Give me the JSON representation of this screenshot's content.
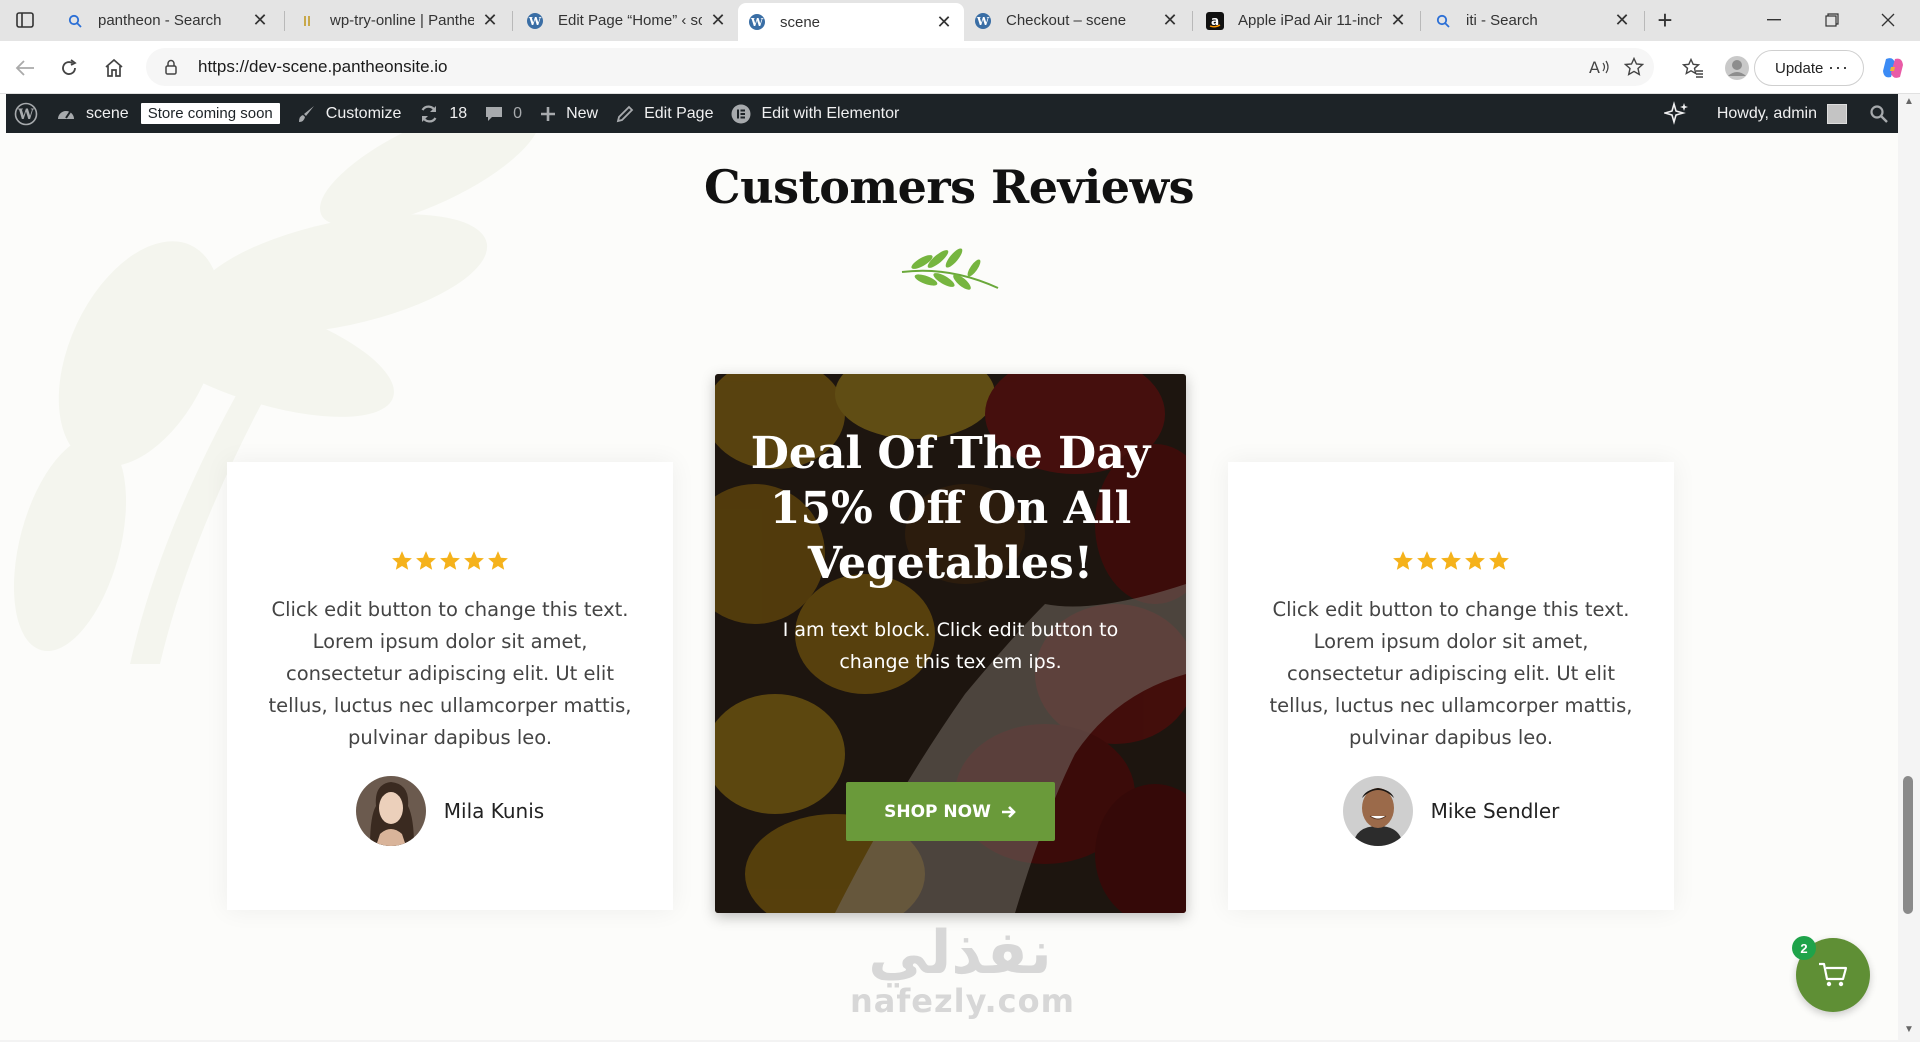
{
  "browser": {
    "tabs": [
      {
        "title": "pantheon - Search",
        "favicon": "search-icon"
      },
      {
        "title": "wp-try-online | Panthe",
        "favicon": "pantheon-icon"
      },
      {
        "title": "Edit Page “Home” ‹ sce",
        "favicon": "wordpress-icon"
      },
      {
        "title": "scene",
        "favicon": "wordpress-icon",
        "active": true
      },
      {
        "title": "Checkout – scene",
        "favicon": "wordpress-icon"
      },
      {
        "title": "Apple iPad Air 11-inch",
        "favicon": "amazon-icon"
      },
      {
        "title": "iti - Search",
        "favicon": "search-icon"
      }
    ],
    "url": "https://dev-scene.pantheonsite.io",
    "update_label": "Update"
  },
  "adminbar": {
    "site_name": "scene",
    "store_badge": "Store coming soon",
    "customize": "Customize",
    "updates_count": "18",
    "comments_count": "0",
    "new": "New",
    "edit_page": "Edit Page",
    "edit_elementor": "Edit with Elementor",
    "howdy": "Howdy, admin"
  },
  "page": {
    "section_title": "Customers Reviews",
    "reviews": [
      {
        "rating": 5,
        "text": "Click edit button to change this text. Lorem ipsum dolor sit amet, consectetur adipiscing elit. Ut elit tellus, luctus nec ullamcorper mattis, pulvinar dapibus leo.",
        "name": "Mila Kunis"
      },
      {
        "rating": 5,
        "text": "Click edit button to change this text. Lorem ipsum dolor sit amet, consectetur adipiscing elit. Ut elit tellus, luctus nec ullamcorper mattis, pulvinar dapibus leo.",
        "name": "Mike Sendler"
      }
    ],
    "promo": {
      "title": "Deal Of The Day 15% Off On All Vegetables!",
      "text": "I am text block. Click edit button to change this tex em ips.",
      "button": "SHOP NOW"
    },
    "watermark_arabic": "نفذلي",
    "watermark_latin": "nafezly.com",
    "cart_count": "2"
  },
  "colors": {
    "accent_green": "#6a9a3a",
    "star_gold": "#f5b21b",
    "adminbar_bg": "#1d2327"
  }
}
